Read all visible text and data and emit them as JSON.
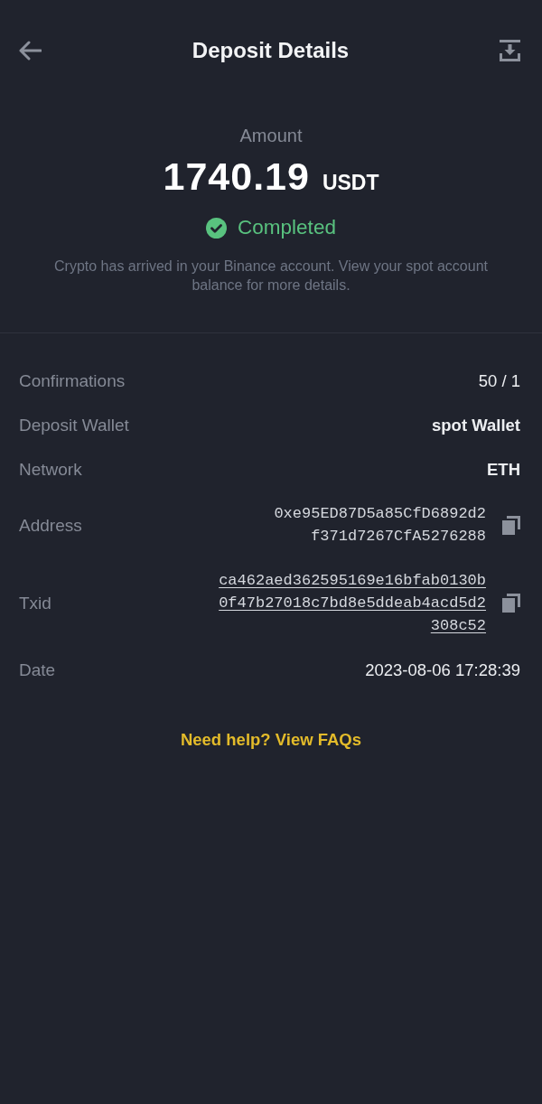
{
  "header": {
    "title": "Deposit Details"
  },
  "summary": {
    "label": "Amount",
    "amount": "1740.19",
    "currency": "USDT",
    "status": {
      "kind": "completed",
      "label": "Completed"
    },
    "message": "Crypto has arrived in your Binance account. View your spot account balance for more details."
  },
  "details": [
    {
      "kind": "text",
      "label": "Confirmations",
      "value": "50 / 1"
    },
    {
      "kind": "strong",
      "label": "Deposit Wallet",
      "value": "spot Wallet"
    },
    {
      "kind": "strong",
      "label": "Network",
      "value": "ETH"
    },
    {
      "kind": "hash",
      "label": "Address",
      "value": "0xe95ED87D5a85CfD6892d2f371d7267CfA5276288"
    },
    {
      "kind": "hash_link",
      "label": "Txid",
      "value": "ca462aed362595169e16bfab0130b0f47b27018c7bd8e5ddeab4acd5d2308c52"
    },
    {
      "kind": "text",
      "label": "Date",
      "value": "2023-08-06 17:28:39"
    }
  ],
  "help_link": "Need help? View FAQs"
}
